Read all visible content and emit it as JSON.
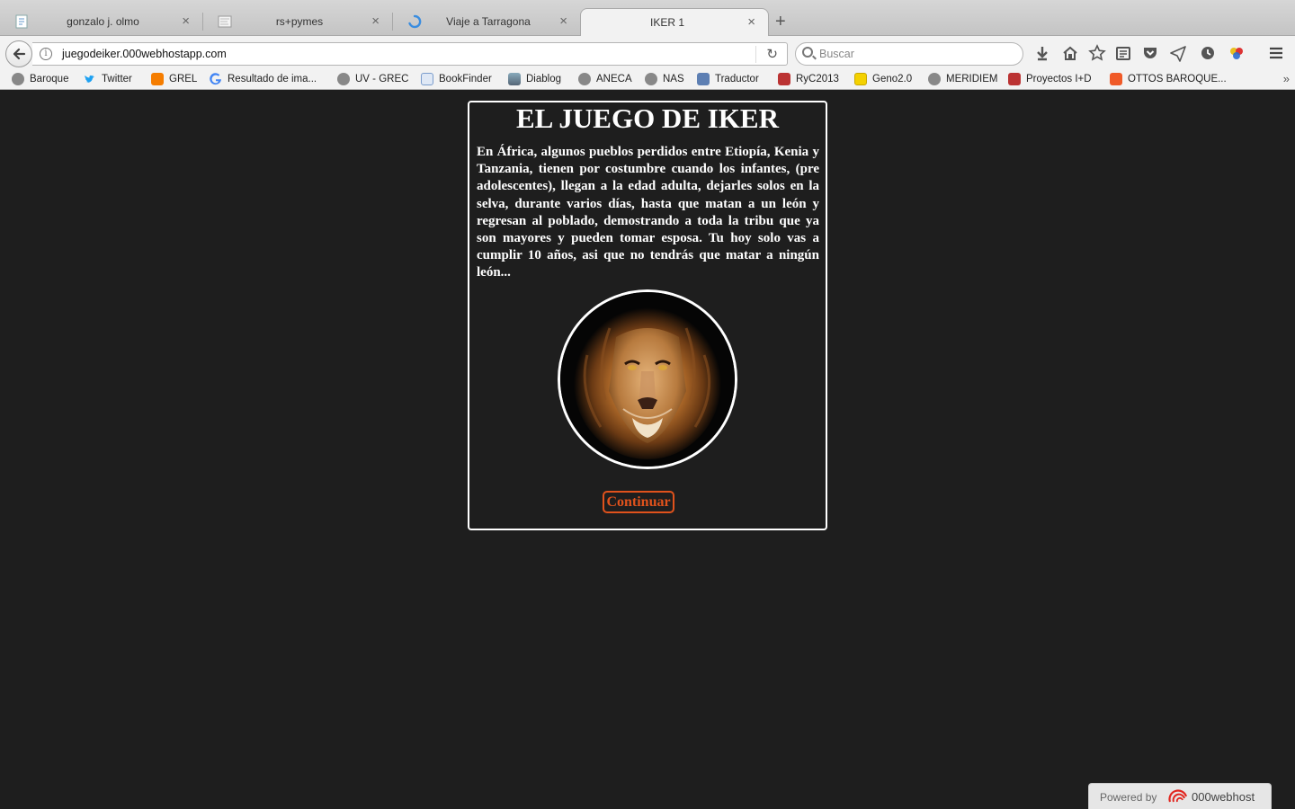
{
  "tabs": [
    {
      "title": "gonzalo j. olmo",
      "favicon": "page-icon"
    },
    {
      "title": "rs+pymes",
      "favicon": "thumbnail-icon"
    },
    {
      "title": "Viaje a Tarragona",
      "favicon": "loading-spinner-icon"
    },
    {
      "title": "IKER 1",
      "favicon": "none",
      "active": true
    }
  ],
  "new_tab_label": "+",
  "url": "juegodeiker.000webhostapp.com",
  "search_placeholder": "Buscar",
  "bookmarks": [
    {
      "label": "Baroque",
      "icon": "globe-icon"
    },
    {
      "label": "Twitter",
      "icon": "twitter-bird-icon"
    },
    {
      "label": "GREL",
      "icon": "blogger-icon"
    },
    {
      "label": "Resultado de ima...",
      "icon": "google-g-icon"
    },
    {
      "label": "UV - GREC",
      "icon": "globe-icon"
    },
    {
      "label": "BookFinder",
      "icon": "bookfinder-icon"
    },
    {
      "label": "Diablog",
      "icon": "image-icon"
    },
    {
      "label": "ANECA",
      "icon": "globe-icon"
    },
    {
      "label": "NAS",
      "icon": "globe-icon"
    },
    {
      "label": "Traductor",
      "icon": "translate-icon"
    },
    {
      "label": "RyC2013",
      "icon": "ministry-crest-icon"
    },
    {
      "label": "Geno2.0",
      "icon": "geno-icon"
    },
    {
      "label": "MERIDIEM",
      "icon": "globe-icon"
    },
    {
      "label": "Proyectos I+D",
      "icon": "ministry-crest-icon"
    },
    {
      "label": "OTTOS BAROQUE...",
      "icon": "orange-page-icon"
    }
  ],
  "page": {
    "title": "EL JUEGO DE IKER",
    "intro": "En África, algunos pueblos perdidos entre Etiopía, Kenia y Tanzania, tienen por costumbre cuando los infantes, (pre adolescentes), llegan a la edad adulta, dejarles solos en la selva, durante varios días, hasta que matan a un león y regresan al poblado, demostrando a toda la tribu que ya son mayores y pueden tomar esposa. Tu hoy solo vas a cumplir 10 años, asi que no tendrás que matar a ningún león...",
    "continue_label": "Continuar",
    "accent_color": "#e0521c"
  },
  "footer": {
    "powered_label": "Powered by",
    "brand": "000webhost"
  }
}
